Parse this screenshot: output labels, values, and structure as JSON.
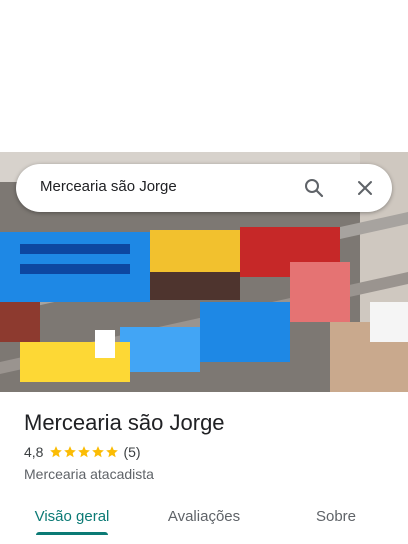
{
  "search": {
    "query": "Mercearia são Jorge"
  },
  "place": {
    "name": "Mercearia são Jorge",
    "rating": "4,8",
    "stars": 5,
    "review_count": "(5)",
    "category": "Mercearia atacadista"
  },
  "tabs": [
    {
      "label": "Visão geral",
      "active": true
    },
    {
      "label": "Avaliações",
      "active": false
    },
    {
      "label": "Sobre",
      "active": false
    }
  ],
  "icons": {
    "search": "search-icon",
    "close": "close-icon",
    "star": "star-icon"
  },
  "colors": {
    "accent": "#0b7a75",
    "star": "#fbbc04"
  }
}
